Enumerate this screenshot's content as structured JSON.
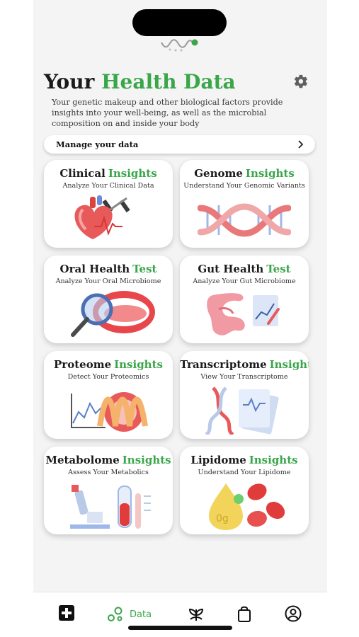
{
  "header": {
    "title_plain": "Your",
    "title_accent": "Health Data",
    "description": "Your genetic makeup and other biological factors provide insights into your well-being, as well as the microbial composition on and inside your body"
  },
  "manage": {
    "label": "Manage your data"
  },
  "cards": [
    {
      "title": "Clinical",
      "accent": "Insights",
      "subtitle": "Analyze Your Clinical Data",
      "icon": "heart-dumbbell-illustration"
    },
    {
      "title": "Genome",
      "accent": "Insights",
      "subtitle": "Understand Your Genomic Variants",
      "icon": "dna-helix-illustration"
    },
    {
      "title": "Oral Health",
      "accent": "Test",
      "subtitle": "Analyze Your Oral Microbiome",
      "icon": "mouth-magnifier-illustration"
    },
    {
      "title": "Gut Health",
      "accent": "Test",
      "subtitle": "Analyze Your Gut Microbiome",
      "icon": "intestine-chart-illustration"
    },
    {
      "title": "Proteome",
      "accent": "Insights",
      "subtitle": "Detect Your Proteomics",
      "icon": "protein-graph-illustration"
    },
    {
      "title": "Transcriptome",
      "accent": "Insights",
      "subtitle": "View Your Transcriptome",
      "icon": "dna-report-illustration"
    },
    {
      "title": "Metabolome",
      "accent": "Insights",
      "subtitle": "Assess Your Metabolics",
      "icon": "microscope-tube-illustration"
    },
    {
      "title": "Lipidome",
      "accent": "Insights",
      "subtitle": "Understand Your Lipidome",
      "icon": "lipid-drop-cells-illustration"
    }
  ],
  "tabbar": {
    "data_label": "Data",
    "active_tab": "data",
    "items": [
      "medical-cross-icon",
      "data-icon",
      "plant-icon",
      "shopping-bag-icon",
      "profile-icon"
    ]
  },
  "colors": {
    "accent": "#3aa64a",
    "background": "#f4f4f4",
    "text": "#1a1a1a"
  }
}
